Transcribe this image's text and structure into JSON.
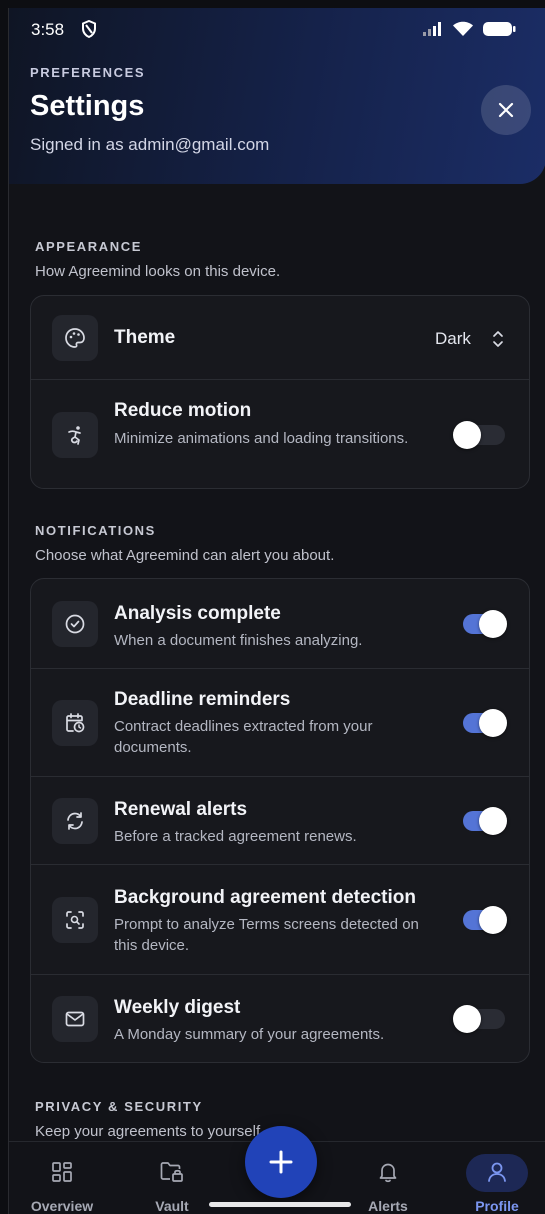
{
  "status_bar": {
    "time": "3:58"
  },
  "header": {
    "eyebrow": "PREFERENCES",
    "title": "Settings",
    "subtitle": "Signed in as admin@gmail.com"
  },
  "appearance": {
    "title": "APPEARANCE",
    "description": "How Agreemind looks on this device.",
    "theme": {
      "label": "Theme",
      "value": "Dark",
      "icon": "palette-icon"
    },
    "reduce_motion": {
      "label": "Reduce motion",
      "description": "Minimize animations and loading transitions.",
      "enabled": false,
      "icon": "accessibility-icon"
    }
  },
  "notifications": {
    "title": "NOTIFICATIONS",
    "description": "Choose what Agreemind can alert you about.",
    "items": [
      {
        "label": "Analysis complete",
        "description": "When a document finishes analyzing.",
        "enabled": true,
        "icon": "check-circle-icon"
      },
      {
        "label": "Deadline reminders",
        "description": "Contract deadlines extracted from your documents.",
        "enabled": true,
        "icon": "calendar-clock-icon"
      },
      {
        "label": "Renewal alerts",
        "description": "Before a tracked agreement renews.",
        "enabled": true,
        "icon": "refresh-icon"
      },
      {
        "label": "Background agreement detection",
        "description": "Prompt to analyze Terms screens detected on this device.",
        "enabled": true,
        "icon": "scan-search-icon"
      },
      {
        "label": "Weekly digest",
        "description": "A Monday summary of your agreements.",
        "enabled": false,
        "icon": "mail-icon"
      }
    ]
  },
  "privacy": {
    "title": "PRIVACY & SECURITY",
    "description": "Keep your agreements to yourself."
  },
  "nav": {
    "items": [
      {
        "label": "Overview",
        "icon": "grid-icon"
      },
      {
        "label": "Vault",
        "icon": "folder-lock-icon"
      },
      {
        "label": "Alerts",
        "icon": "bell-icon"
      },
      {
        "label": "Profile",
        "icon": "user-icon",
        "active": true
      }
    ],
    "fab_icon": "plus-icon"
  },
  "colors": {
    "accent": "#5474d6",
    "fab": "#2143b8",
    "background": "#121318"
  }
}
